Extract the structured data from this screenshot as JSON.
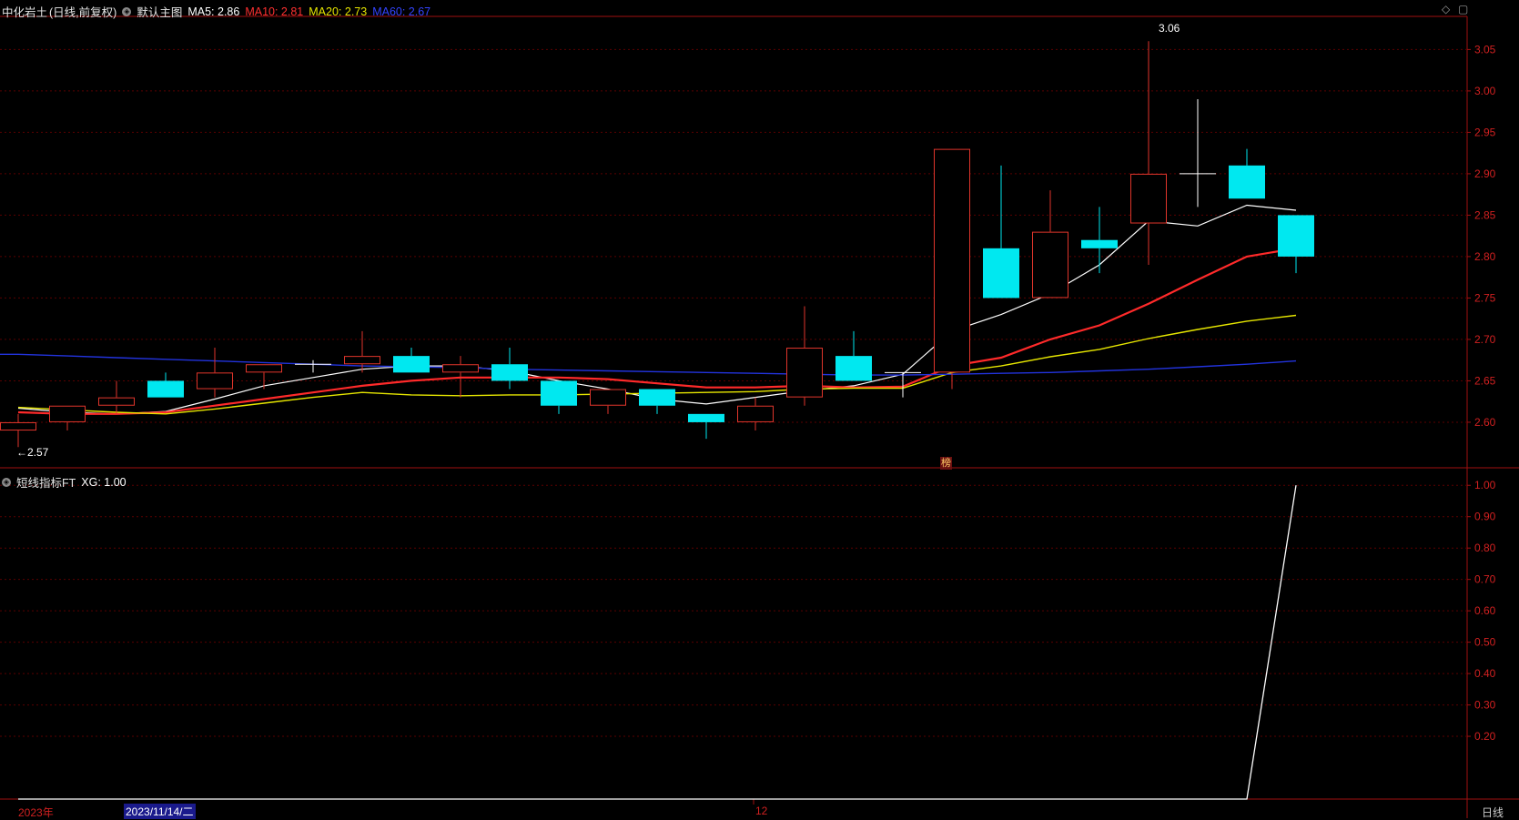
{
  "main_header": {
    "stock_name": "中化岩土",
    "mode": "(日线,前复权)",
    "template": "默认主图",
    "ma5": "MA5: 2.86",
    "ma10": "MA10: 2.81",
    "ma20": "MA20: 2.73",
    "ma60": "MA60: 2.67"
  },
  "sub_header": {
    "indicator": "短线指标FT",
    "xg": "XG: 1.00"
  },
  "bottom_bar": {
    "year_label": "2023年",
    "cursor_date": "2023/11/14/二",
    "month_label": "12",
    "period_label": "日线"
  },
  "badge_label": "榜",
  "annotations": {
    "high": "3.06",
    "low": "←2.57"
  },
  "colors": {
    "up": "#e0352b",
    "down": "#00e8f0",
    "ma5": "#ffffff",
    "ma10": "#ff2a2a",
    "ma20": "#e6e600",
    "ma60": "#2233dd",
    "grid": "#5a0000",
    "axis": "#a01010",
    "background": "#000000"
  },
  "icons": {
    "expand": "diamond-icon",
    "layout": "window-icon",
    "settings": "settings-circle-icon"
  },
  "chart_data": [
    {
      "type": "candlestick",
      "ylim": [
        2.545,
        3.09
      ],
      "yticks": [
        2.6,
        2.65,
        2.7,
        2.75,
        2.8,
        2.85,
        2.9,
        2.95,
        3.0,
        3.05
      ],
      "ytick_labels": [
        "2.60",
        "2.65",
        "2.70",
        "2.75",
        "2.80",
        "2.85",
        "2.90",
        "2.95",
        "3.00",
        "3.05"
      ],
      "candles": [
        {
          "o": 2.59,
          "h": 2.61,
          "l": 2.57,
          "c": 2.6
        },
        {
          "o": 2.6,
          "h": 2.62,
          "l": 2.59,
          "c": 2.62
        },
        {
          "o": 2.62,
          "h": 2.65,
          "l": 2.61,
          "c": 2.63
        },
        {
          "o": 2.65,
          "h": 2.66,
          "l": 2.63,
          "c": 2.63
        },
        {
          "o": 2.64,
          "h": 2.69,
          "l": 2.63,
          "c": 2.66
        },
        {
          "o": 2.66,
          "h": 2.67,
          "l": 2.64,
          "c": 2.67
        },
        {
          "o": 2.67,
          "h": 2.675,
          "l": 2.66,
          "c": 2.67
        },
        {
          "o": 2.67,
          "h": 2.71,
          "l": 2.66,
          "c": 2.68
        },
        {
          "o": 2.68,
          "h": 2.69,
          "l": 2.66,
          "c": 2.66
        },
        {
          "o": 2.66,
          "h": 2.68,
          "l": 2.63,
          "c": 2.67
        },
        {
          "o": 2.67,
          "h": 2.69,
          "l": 2.64,
          "c": 2.65
        },
        {
          "o": 2.65,
          "h": 2.65,
          "l": 2.61,
          "c": 2.62
        },
        {
          "o": 2.62,
          "h": 2.64,
          "l": 2.61,
          "c": 2.64
        },
        {
          "o": 2.64,
          "h": 2.64,
          "l": 2.61,
          "c": 2.62
        },
        {
          "o": 2.61,
          "h": 2.61,
          "l": 2.58,
          "c": 2.6
        },
        {
          "o": 2.6,
          "h": 2.63,
          "l": 2.59,
          "c": 2.62
        },
        {
          "o": 2.63,
          "h": 2.74,
          "l": 2.62,
          "c": 2.69
        },
        {
          "o": 2.68,
          "h": 2.71,
          "l": 2.65,
          "c": 2.65
        },
        {
          "o": 2.66,
          "h": 2.66,
          "l": 2.63,
          "c": 2.66
        },
        {
          "o": 2.66,
          "h": 2.93,
          "l": 2.64,
          "c": 2.93
        },
        {
          "o": 2.81,
          "h": 2.91,
          "l": 2.75,
          "c": 2.75
        },
        {
          "o": 2.75,
          "h": 2.88,
          "l": 2.75,
          "c": 2.83
        },
        {
          "o": 2.82,
          "h": 2.86,
          "l": 2.78,
          "c": 2.81
        },
        {
          "o": 2.84,
          "h": 3.06,
          "l": 2.79,
          "c": 2.9
        },
        {
          "o": 2.9,
          "h": 2.99,
          "l": 2.86,
          "c": 2.9
        },
        {
          "o": 2.91,
          "h": 2.93,
          "l": 2.87,
          "c": 2.87
        },
        {
          "o": 2.85,
          "h": 2.85,
          "l": 2.78,
          "c": 2.8
        }
      ],
      "series": [
        {
          "name": "MA5",
          "values": [
            2.617,
            2.612,
            2.61,
            2.613,
            2.628,
            2.644,
            2.654,
            2.664,
            2.668,
            2.668,
            2.662,
            2.65,
            2.64,
            2.628,
            2.622,
            2.63,
            2.638,
            2.644,
            2.658,
            2.71,
            2.73,
            2.755,
            2.79,
            2.843,
            2.837,
            2.862,
            2.856
          ]
        },
        {
          "name": "MA10",
          "values": [
            2.612,
            2.61,
            2.61,
            2.612,
            2.62,
            2.628,
            2.636,
            2.644,
            2.65,
            2.654,
            2.654,
            2.654,
            2.652,
            2.647,
            2.642,
            2.642,
            2.644,
            2.642,
            2.643,
            2.668,
            2.678,
            2.7,
            2.717,
            2.743,
            2.772,
            2.8,
            2.81
          ]
        },
        {
          "name": "MA20",
          "values": [
            2.618,
            2.615,
            2.612,
            2.61,
            2.616,
            2.623,
            2.63,
            2.636,
            2.633,
            2.632,
            2.633,
            2.633,
            2.634,
            2.635,
            2.636,
            2.637,
            2.64,
            2.641,
            2.641,
            2.66,
            2.668,
            2.679,
            2.688,
            2.701,
            2.712,
            2.722,
            2.729
          ]
        },
        {
          "name": "MA60",
          "values": [
            2.682,
            2.68,
            2.678,
            2.676,
            2.674,
            2.672,
            2.67,
            2.668,
            2.667,
            2.666,
            2.664,
            2.663,
            2.662,
            2.661,
            2.66,
            2.659,
            2.658,
            2.657,
            2.657,
            2.658,
            2.659,
            2.66,
            2.662,
            2.664,
            2.667,
            2.67,
            2.674
          ]
        }
      ]
    },
    {
      "type": "line",
      "ylim": [
        0.0,
        1.05
      ],
      "yticks": [
        0.2,
        0.3,
        0.4,
        0.5,
        0.6,
        0.7,
        0.8,
        0.9,
        1.0
      ],
      "ytick_labels": [
        "0.20",
        "0.30",
        "0.40",
        "0.50",
        "0.60",
        "0.70",
        "0.80",
        "0.90",
        "1.00"
      ],
      "series": [
        {
          "name": "XG",
          "values": [
            0,
            0,
            0,
            0,
            0,
            0,
            0,
            0,
            0,
            0,
            0,
            0,
            0,
            0,
            0,
            0,
            0,
            0,
            0,
            0,
            0,
            0,
            0,
            0,
            0,
            0,
            1.0
          ]
        }
      ]
    }
  ]
}
